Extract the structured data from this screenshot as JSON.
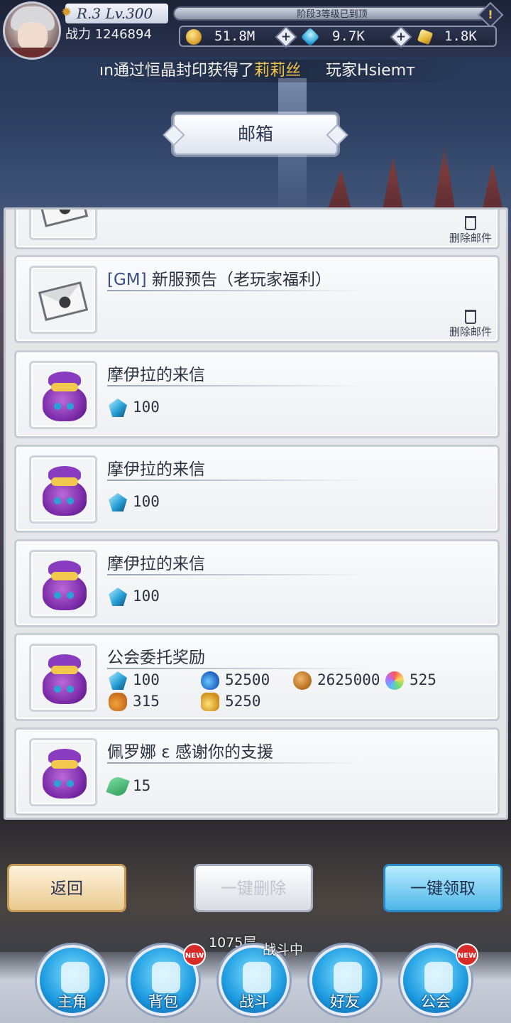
{
  "header": {
    "rank_level": "R.3 Lv.300",
    "power_label": "战力",
    "power_value": "1246894",
    "stage_notice": "阶段3等级已到顶",
    "currencies": [
      {
        "icon": "gold-coin-icon",
        "value": "51.8M"
      },
      {
        "icon": "blue-gem-icon",
        "value": "9.7K"
      },
      {
        "icon": "gold-crystal-icon",
        "value": "1.8K"
      }
    ]
  },
  "ticker": {
    "prefix": "ın通过恒晶封印获得了",
    "highlight": "莉莉丝",
    "suffix": "玩家Hsiemт"
  },
  "mailbox": {
    "title": "邮箱",
    "delete_label": "删除邮件",
    "mails": [
      {
        "type": "letter",
        "tag": "",
        "title": "",
        "rewards": []
      },
      {
        "type": "letter",
        "tag": "[GM]",
        "title": "新服预告（老玩家福利）",
        "rewards": []
      },
      {
        "type": "bag",
        "tag": "",
        "title": "摩伊拉的来信",
        "rewards": [
          {
            "icon": "gem",
            "value": "100"
          }
        ]
      },
      {
        "type": "bag",
        "tag": "",
        "title": "摩伊拉的来信",
        "rewards": [
          {
            "icon": "gem",
            "value": "100"
          }
        ]
      },
      {
        "type": "bag",
        "tag": "",
        "title": "摩伊拉的来信",
        "rewards": [
          {
            "icon": "gem",
            "value": "100"
          }
        ]
      },
      {
        "type": "bag",
        "tag": "",
        "title": "公会委托奖励",
        "rewards": [
          {
            "icon": "gem",
            "value": "100"
          },
          {
            "icon": "potion",
            "value": "52500"
          },
          {
            "icon": "coin",
            "value": "2625000"
          },
          {
            "icon": "wheel",
            "value": "525"
          },
          {
            "icon": "fruit",
            "value": "315"
          },
          {
            "icon": "golden",
            "value": "5250"
          }
        ]
      },
      {
        "type": "bag",
        "tag": "",
        "title": "佩罗娜 ε 感谢你的支援",
        "rewards": [
          {
            "icon": "leaf",
            "value": "15"
          }
        ]
      }
    ]
  },
  "actions": {
    "back": "返回",
    "delete_all": "一键删除",
    "claim_all": "一键领取"
  },
  "status": {
    "floor": "1075层",
    "battle": "战斗中"
  },
  "nav": [
    {
      "label": "主角",
      "icon": "hero-icon",
      "badge": ""
    },
    {
      "label": "背包",
      "icon": "backpack-icon",
      "badge": "NEW"
    },
    {
      "label": "战斗",
      "icon": "crossed-swords-icon",
      "badge": ""
    },
    {
      "label": "好友",
      "icon": "handshake-icon",
      "badge": ""
    },
    {
      "label": "公会",
      "icon": "guild-crest-icon",
      "badge": "NEW"
    }
  ]
}
